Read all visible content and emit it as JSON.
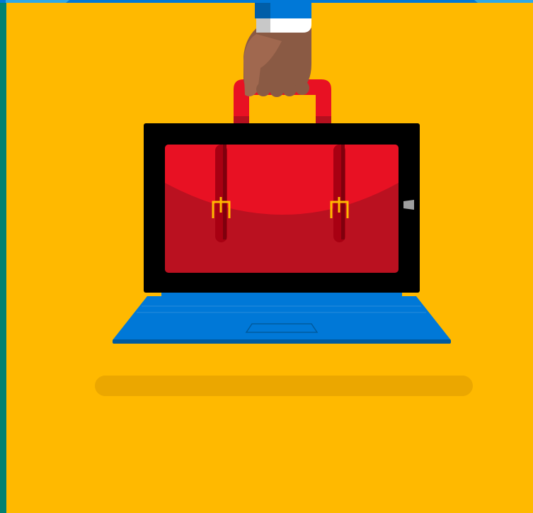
{
  "illustration": {
    "subject": "hand-carrying-laptop-briefcase",
    "icons": [
      "hand-icon",
      "briefcase-icon",
      "tablet-icon",
      "keyboard-icon",
      "windows-button-icon"
    ]
  },
  "colors": {
    "background": "#FFB900",
    "left_strip": "#008272",
    "top_strip": "#0078D7",
    "top_strip_light": "#2EA8E6",
    "sleeve": "#0078D7",
    "sleeve_dark": "#005EA8",
    "cuff": "#FFFFFF",
    "cuff_shadow": "#C8C8C8",
    "skin": "#8A5A44",
    "skin_light": "#A0684F",
    "handle": "#E81123",
    "handle_dark": "#B4101E",
    "tablet_bezel": "#000000",
    "briefcase_top": "#E81123",
    "briefcase_bottom": "#BA1120",
    "strap": "#A80012",
    "strap_dark": "#7F000D",
    "buckle": "#FFB900",
    "windows_button": "#9E9E9E",
    "keyboard": "#0078D7",
    "keyboard_dark": "#005A9E",
    "keyboard_line": "#1A86DA",
    "shadow": "#EBA700"
  }
}
